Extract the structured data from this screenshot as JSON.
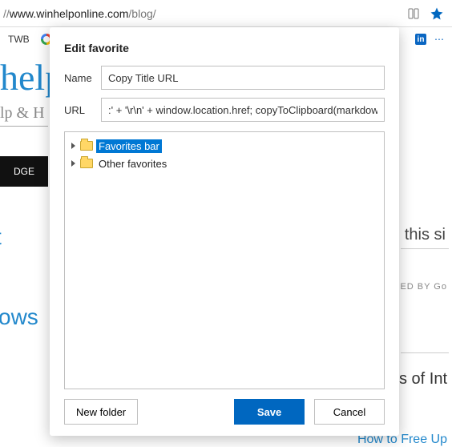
{
  "address_bar": {
    "url_prefix": "//",
    "url_host": "www.winhelponline.com",
    "url_path": "/blog/"
  },
  "bookmarks": {
    "item1": "TWB"
  },
  "background": {
    "site_title_fragment": "help",
    "site_tagline_fragment": "lp & H",
    "dark_bar_text": "DGE",
    "left_text_1": "t",
    "left_text_2": "ows",
    "right_text_1": "this si",
    "right_text_2": "CED BY  Go",
    "right_text_3": "s of Int",
    "right_text_4": "How to Free Up"
  },
  "dialog": {
    "title": "Edit favorite",
    "name_label": "Name",
    "name_value": "Copy Title URL",
    "url_label": "URL",
    "url_value": ":' + '\\r\\n' + window.location.href; copyToClipboard(markdown); })();",
    "tree": {
      "item1": "Favorites bar",
      "item2": "Other favorites"
    },
    "buttons": {
      "new_folder": "New folder",
      "save": "Save",
      "cancel": "Cancel"
    }
  }
}
